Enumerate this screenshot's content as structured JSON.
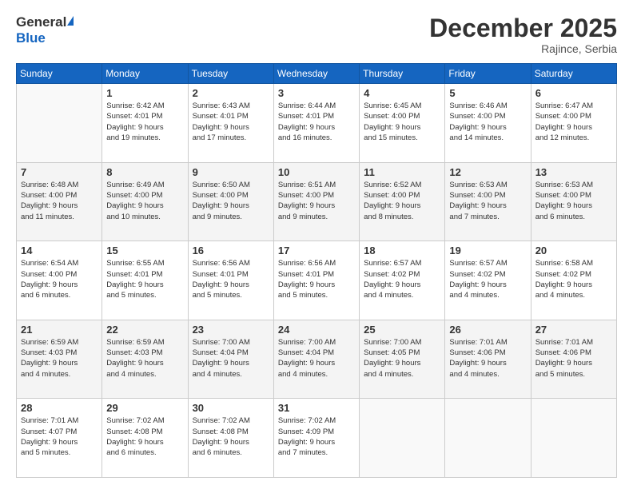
{
  "logo": {
    "general": "General",
    "blue": "Blue"
  },
  "header": {
    "month_year": "December 2025",
    "location": "Rajince, Serbia"
  },
  "weekdays": [
    "Sunday",
    "Monday",
    "Tuesday",
    "Wednesday",
    "Thursday",
    "Friday",
    "Saturday"
  ],
  "weeks": [
    [
      {
        "day": "",
        "info": ""
      },
      {
        "day": "1",
        "info": "Sunrise: 6:42 AM\nSunset: 4:01 PM\nDaylight: 9 hours\nand 19 minutes."
      },
      {
        "day": "2",
        "info": "Sunrise: 6:43 AM\nSunset: 4:01 PM\nDaylight: 9 hours\nand 17 minutes."
      },
      {
        "day": "3",
        "info": "Sunrise: 6:44 AM\nSunset: 4:01 PM\nDaylight: 9 hours\nand 16 minutes."
      },
      {
        "day": "4",
        "info": "Sunrise: 6:45 AM\nSunset: 4:00 PM\nDaylight: 9 hours\nand 15 minutes."
      },
      {
        "day": "5",
        "info": "Sunrise: 6:46 AM\nSunset: 4:00 PM\nDaylight: 9 hours\nand 14 minutes."
      },
      {
        "day": "6",
        "info": "Sunrise: 6:47 AM\nSunset: 4:00 PM\nDaylight: 9 hours\nand 12 minutes."
      }
    ],
    [
      {
        "day": "7",
        "info": "Sunrise: 6:48 AM\nSunset: 4:00 PM\nDaylight: 9 hours\nand 11 minutes."
      },
      {
        "day": "8",
        "info": "Sunrise: 6:49 AM\nSunset: 4:00 PM\nDaylight: 9 hours\nand 10 minutes."
      },
      {
        "day": "9",
        "info": "Sunrise: 6:50 AM\nSunset: 4:00 PM\nDaylight: 9 hours\nand 9 minutes."
      },
      {
        "day": "10",
        "info": "Sunrise: 6:51 AM\nSunset: 4:00 PM\nDaylight: 9 hours\nand 9 minutes."
      },
      {
        "day": "11",
        "info": "Sunrise: 6:52 AM\nSunset: 4:00 PM\nDaylight: 9 hours\nand 8 minutes."
      },
      {
        "day": "12",
        "info": "Sunrise: 6:53 AM\nSunset: 4:00 PM\nDaylight: 9 hours\nand 7 minutes."
      },
      {
        "day": "13",
        "info": "Sunrise: 6:53 AM\nSunset: 4:00 PM\nDaylight: 9 hours\nand 6 minutes."
      }
    ],
    [
      {
        "day": "14",
        "info": "Sunrise: 6:54 AM\nSunset: 4:00 PM\nDaylight: 9 hours\nand 6 minutes."
      },
      {
        "day": "15",
        "info": "Sunrise: 6:55 AM\nSunset: 4:01 PM\nDaylight: 9 hours\nand 5 minutes."
      },
      {
        "day": "16",
        "info": "Sunrise: 6:56 AM\nSunset: 4:01 PM\nDaylight: 9 hours\nand 5 minutes."
      },
      {
        "day": "17",
        "info": "Sunrise: 6:56 AM\nSunset: 4:01 PM\nDaylight: 9 hours\nand 5 minutes."
      },
      {
        "day": "18",
        "info": "Sunrise: 6:57 AM\nSunset: 4:02 PM\nDaylight: 9 hours\nand 4 minutes."
      },
      {
        "day": "19",
        "info": "Sunrise: 6:57 AM\nSunset: 4:02 PM\nDaylight: 9 hours\nand 4 minutes."
      },
      {
        "day": "20",
        "info": "Sunrise: 6:58 AM\nSunset: 4:02 PM\nDaylight: 9 hours\nand 4 minutes."
      }
    ],
    [
      {
        "day": "21",
        "info": "Sunrise: 6:59 AM\nSunset: 4:03 PM\nDaylight: 9 hours\nand 4 minutes."
      },
      {
        "day": "22",
        "info": "Sunrise: 6:59 AM\nSunset: 4:03 PM\nDaylight: 9 hours\nand 4 minutes."
      },
      {
        "day": "23",
        "info": "Sunrise: 7:00 AM\nSunset: 4:04 PM\nDaylight: 9 hours\nand 4 minutes."
      },
      {
        "day": "24",
        "info": "Sunrise: 7:00 AM\nSunset: 4:04 PM\nDaylight: 9 hours\nand 4 minutes."
      },
      {
        "day": "25",
        "info": "Sunrise: 7:00 AM\nSunset: 4:05 PM\nDaylight: 9 hours\nand 4 minutes."
      },
      {
        "day": "26",
        "info": "Sunrise: 7:01 AM\nSunset: 4:06 PM\nDaylight: 9 hours\nand 4 minutes."
      },
      {
        "day": "27",
        "info": "Sunrise: 7:01 AM\nSunset: 4:06 PM\nDaylight: 9 hours\nand 5 minutes."
      }
    ],
    [
      {
        "day": "28",
        "info": "Sunrise: 7:01 AM\nSunset: 4:07 PM\nDaylight: 9 hours\nand 5 minutes."
      },
      {
        "day": "29",
        "info": "Sunrise: 7:02 AM\nSunset: 4:08 PM\nDaylight: 9 hours\nand 6 minutes."
      },
      {
        "day": "30",
        "info": "Sunrise: 7:02 AM\nSunset: 4:08 PM\nDaylight: 9 hours\nand 6 minutes."
      },
      {
        "day": "31",
        "info": "Sunrise: 7:02 AM\nSunset: 4:09 PM\nDaylight: 9 hours\nand 7 minutes."
      },
      {
        "day": "",
        "info": ""
      },
      {
        "day": "",
        "info": ""
      },
      {
        "day": "",
        "info": ""
      }
    ]
  ]
}
